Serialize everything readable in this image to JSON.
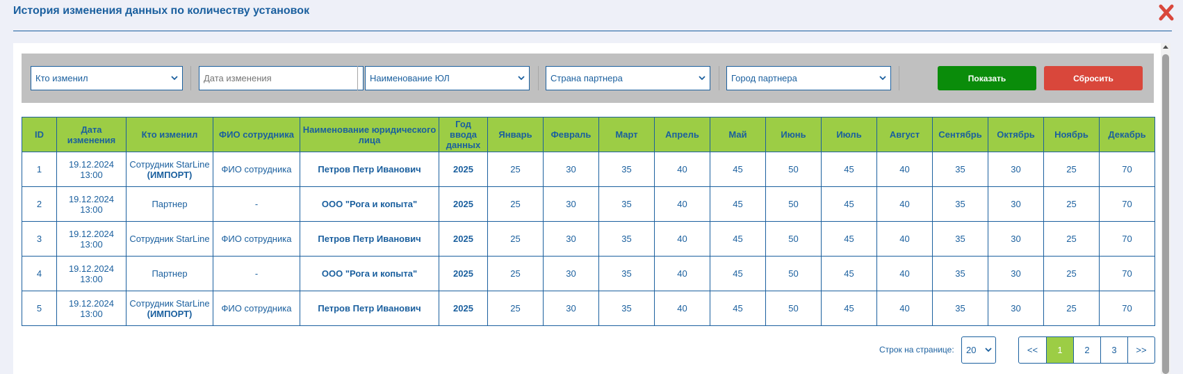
{
  "header": {
    "title": "История изменения данных по количеству установок"
  },
  "colors": {
    "primary": "#1a5f9e",
    "header_bg": "#9ccd45",
    "show_button": "#0a8c0a",
    "reset_button": "#d9473b",
    "close_icon": "#d9473b"
  },
  "icons": {
    "close": "close-icon",
    "dropdown": "chevron-down-icon"
  },
  "filters": {
    "who_changed": "Кто изменил",
    "change_date_placeholder": "Дата изменения",
    "legal_name": "Наименование ЮЛ",
    "partner_country": "Страна партнера",
    "partner_city": "Город партнера",
    "show_label": "Показать",
    "reset_label": "Сбросить"
  },
  "table": {
    "columns": [
      "ID",
      "Дата изменения",
      "Кто изменил",
      "ФИО сотрудника",
      "Наименование юридического лица",
      "Год ввода данных",
      "Январь",
      "Февраль",
      "Март",
      "Апрель",
      "Май",
      "Июнь",
      "Июль",
      "Август",
      "Сентябрь",
      "Октябрь",
      "Ноябрь",
      "Декабрь"
    ],
    "rows": [
      {
        "id": "1",
        "date": "19.12.2024",
        "time": "13:00",
        "who": "Сотрудник StarLine",
        "who_note": "(ИМПОРТ)",
        "employee": "ФИО сотрудника",
        "legal": "Петров Петр Иванович",
        "year": "2025",
        "months": [
          "25",
          "30",
          "35",
          "40",
          "45",
          "50",
          "45",
          "40",
          "35",
          "30",
          "25",
          "70"
        ]
      },
      {
        "id": "2",
        "date": "19.12.2024",
        "time": "13:00",
        "who": "Партнер",
        "who_note": "",
        "employee": "-",
        "legal": "ООО \"Рога и копыта\"",
        "year": "2025",
        "months": [
          "25",
          "30",
          "35",
          "40",
          "45",
          "50",
          "45",
          "40",
          "35",
          "30",
          "25",
          "70"
        ]
      },
      {
        "id": "3",
        "date": "19.12.2024",
        "time": "13:00",
        "who": "Сотрудник StarLine",
        "who_note": "",
        "employee": "ФИО сотрудника",
        "legal": "Петров Петр Иванович",
        "year": "2025",
        "months": [
          "25",
          "30",
          "35",
          "40",
          "45",
          "50",
          "45",
          "40",
          "35",
          "30",
          "25",
          "70"
        ]
      },
      {
        "id": "4",
        "date": "19.12.2024",
        "time": "13:00",
        "who": "Партнер",
        "who_note": "",
        "employee": "-",
        "legal": "ООО \"Рога и копыта\"",
        "year": "2025",
        "months": [
          "25",
          "30",
          "35",
          "40",
          "45",
          "50",
          "45",
          "40",
          "35",
          "30",
          "25",
          "70"
        ]
      },
      {
        "id": "5",
        "date": "19.12.2024",
        "time": "13:00",
        "who": "Сотрудник StarLine",
        "who_note": "(ИМПОРТ)",
        "employee": "ФИО сотрудника",
        "legal": "Петров Петр Иванович",
        "year": "2025",
        "months": [
          "25",
          "30",
          "35",
          "40",
          "45",
          "50",
          "45",
          "40",
          "35",
          "30",
          "25",
          "70"
        ]
      }
    ]
  },
  "pagination": {
    "rows_label": "Строк на странице:",
    "rows_per_page": "20",
    "first_label": "<<",
    "last_label": ">>",
    "pages": [
      "1",
      "2",
      "3"
    ],
    "current_page": "1"
  }
}
